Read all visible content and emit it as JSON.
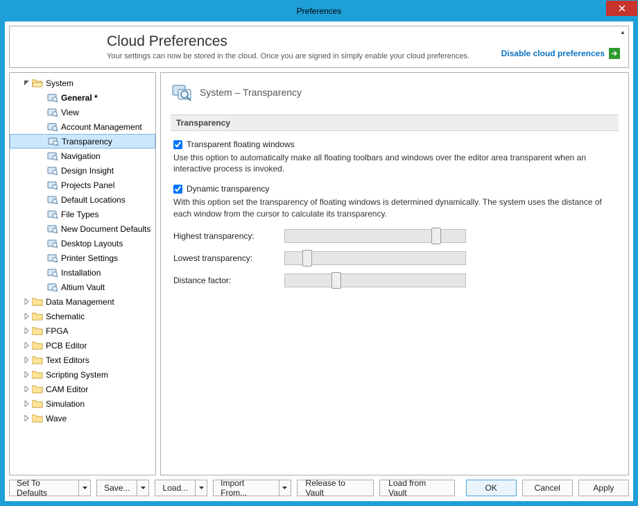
{
  "window": {
    "title": "Preferences"
  },
  "banner": {
    "title": "Cloud Preferences",
    "subtitle": "Your settings can now be stored in the cloud. Once you are signed in simply enable your cloud preferences.",
    "action": "Disable cloud preferences"
  },
  "tree": {
    "root": "System",
    "children": [
      {
        "label": "General *",
        "bold": true
      },
      {
        "label": "View"
      },
      {
        "label": "Account Management"
      },
      {
        "label": "Transparency",
        "selected": true
      },
      {
        "label": "Navigation"
      },
      {
        "label": "Design Insight"
      },
      {
        "label": "Projects Panel"
      },
      {
        "label": "Default Locations"
      },
      {
        "label": "File Types"
      },
      {
        "label": "New Document Defaults"
      },
      {
        "label": "Desktop Layouts"
      },
      {
        "label": "Printer Settings"
      },
      {
        "label": "Installation"
      },
      {
        "label": "Altium Vault"
      }
    ],
    "siblings": [
      "Data Management",
      "Schematic",
      "FPGA",
      "PCB Editor",
      "Text Editors",
      "Scripting System",
      "CAM Editor",
      "Simulation",
      "Wave"
    ]
  },
  "main": {
    "heading": "System – Transparency",
    "section": "Transparency",
    "chk1": {
      "label": "Transparent floating windows",
      "checked": true
    },
    "desc1": "Use this option to automatically make all floating toolbars and windows over the editor area transparent when an interactive process is invoked.",
    "chk2": {
      "label": "Dynamic transparency",
      "checked": true
    },
    "desc2": "With this option set the transparency of floating windows is determined dynamically. The system uses the distance of each window from the cursor to calculate its transparency.",
    "sliders": [
      {
        "label": "Highest transparency:",
        "pos": 85
      },
      {
        "label": "Lowest transparency:",
        "pos": 10
      },
      {
        "label": "Distance factor:",
        "pos": 27
      }
    ]
  },
  "footer": {
    "set_defaults": "Set To Defaults",
    "save": "Save...",
    "load": "Load...",
    "import": "Import From...",
    "release": "Release to Vault",
    "loadvault": "Load from Vault",
    "ok": "OK",
    "cancel": "Cancel",
    "apply": "Apply"
  }
}
